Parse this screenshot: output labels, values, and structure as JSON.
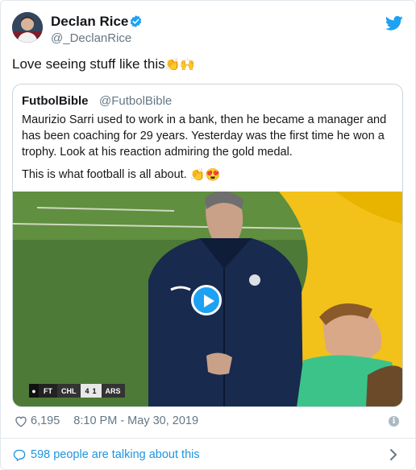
{
  "author": {
    "display_name": "Declan Rice",
    "handle": "@_DeclanRice",
    "avatar_icon": "avatar-photo",
    "verified_icon": "verified-badge-icon"
  },
  "tweet": {
    "text": "Love seeing stuff like this",
    "emojis": [
      "👏",
      "🙌"
    ]
  },
  "quoted_tweet": {
    "name": "FutbolBible",
    "handle": "@FutbolBible",
    "text": "Maurizio Sarri used to work in a bank, then he became a manager and has been coaching for 29 years. Yesterday was the first time he won a trophy. Look at his reaction admiring the gold medal.",
    "text2": "This is what football is all about.",
    "emojis2": [
      "👏",
      "😍"
    ],
    "video": {
      "scorebug": {
        "status": "FT",
        "home": "CHL",
        "home_score": "4",
        "away_score": "1",
        "away": "ARS"
      }
    }
  },
  "meta": {
    "likes": "6,195",
    "timestamp": "8:10 PM - May 30, 2019"
  },
  "footer": {
    "talking": "598 people are talking about this"
  },
  "colors": {
    "accent": "#1da1f2",
    "link": "#1b95e0",
    "secondary_text": "#657786"
  }
}
